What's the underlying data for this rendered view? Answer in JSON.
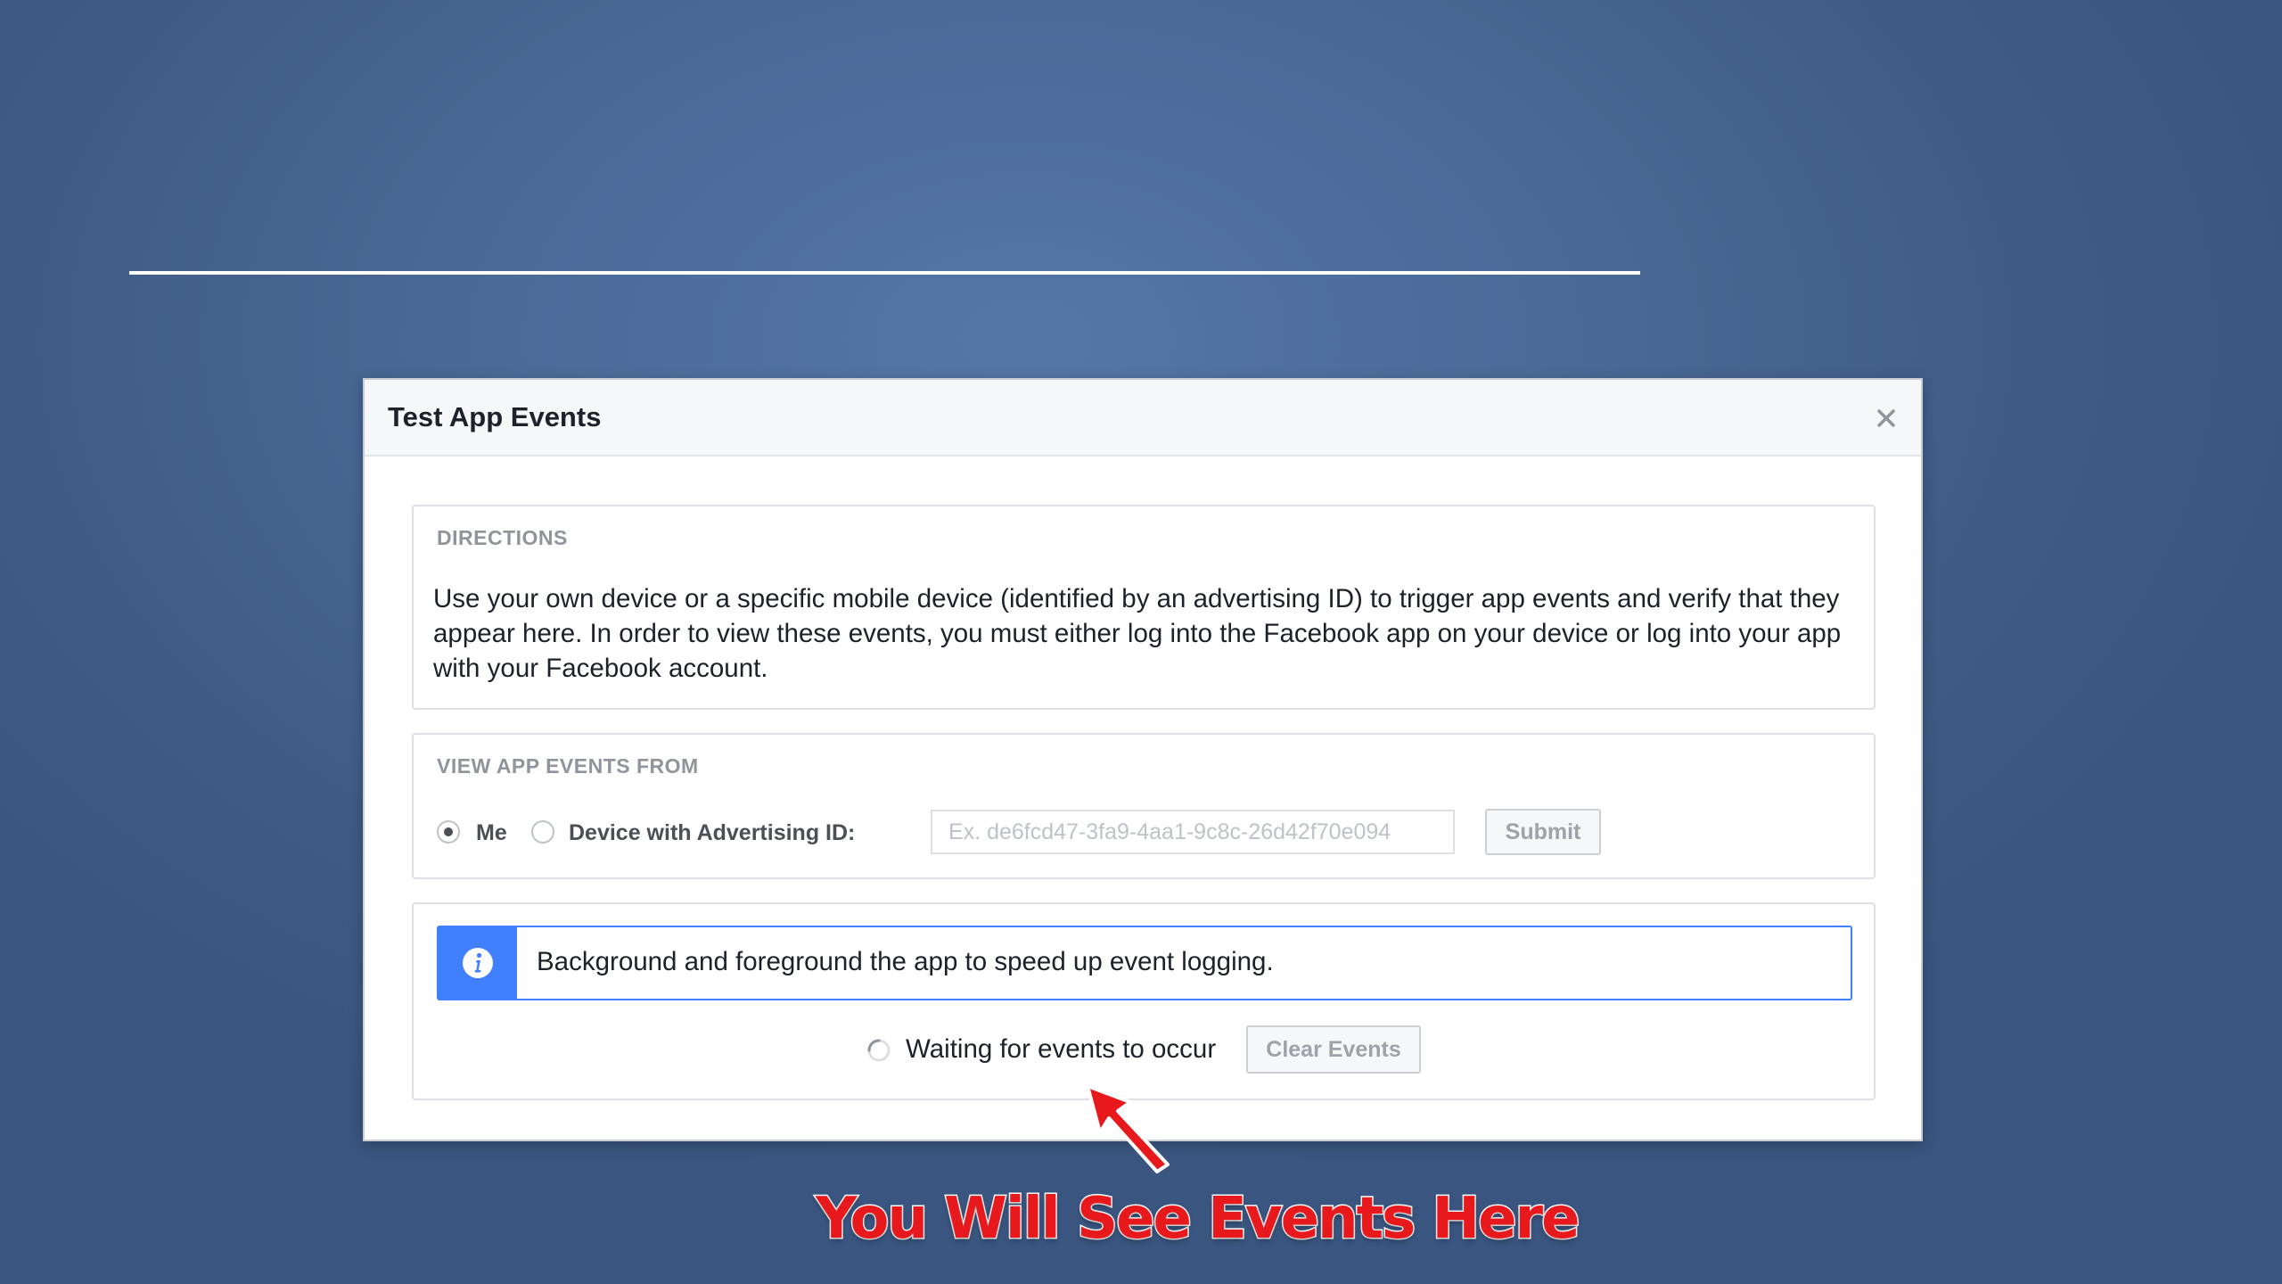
{
  "dialog": {
    "title": "Test App Events",
    "close_label": "×"
  },
  "directions": {
    "heading": "DIRECTIONS",
    "text": "Use your own device or a specific mobile device (identified by an advertising ID) to trigger app events and verify that they appear here. In order to view these events, you must either log into the Facebook app on your device or log into your app with your Facebook account."
  },
  "view_from": {
    "heading": "VIEW APP EVENTS FROM",
    "options": [
      {
        "label": "Me",
        "selected": true
      },
      {
        "label": "Device with Advertising ID:",
        "selected": false
      }
    ],
    "advertising_id": {
      "value": "",
      "placeholder": "Ex. de6fcd47-3fa9-4aa1-9c8c-26d42f70e094"
    },
    "submit_label": "Submit"
  },
  "events": {
    "info_icon": "info-icon",
    "info_text": "Background and foreground the app to speed up event logging.",
    "waiting_text": "Waiting for events to occur",
    "clear_label": "Clear Events"
  },
  "annotation": {
    "text": "You Will See Events Here",
    "color": "#e8191d",
    "arrow_icon": "red-arrow-icon"
  },
  "colors": {
    "accent": "#4080ff",
    "background": "#4a6a98"
  }
}
